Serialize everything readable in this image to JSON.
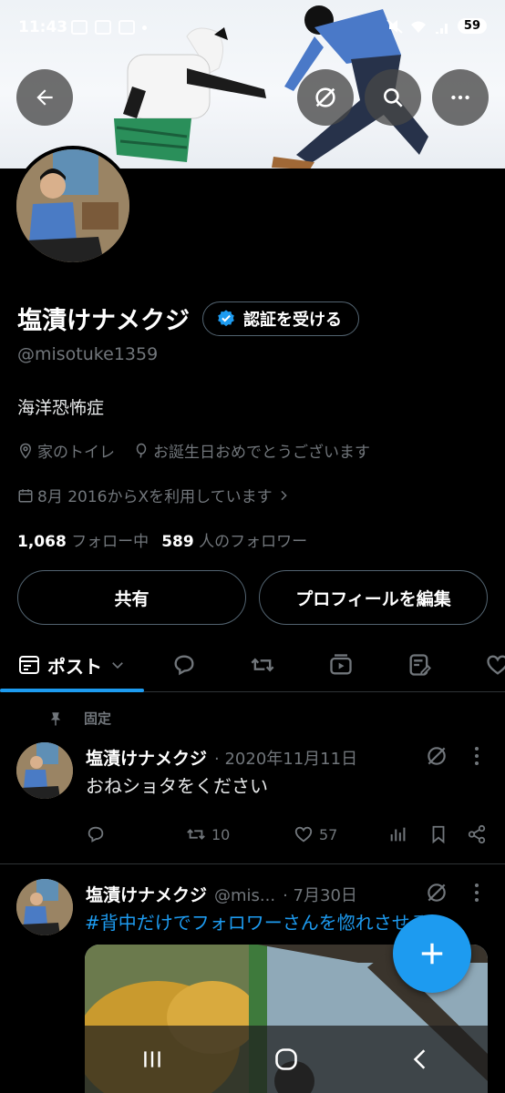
{
  "status_bar": {
    "time": "11:43",
    "battery": "59"
  },
  "header": {
    "back_icon": "arrow-left-icon",
    "grok_icon": "grok-icon",
    "search_icon": "search-icon",
    "more_icon": "more-horizontal-icon"
  },
  "profile": {
    "display_name": "塩漬けナメクジ",
    "verify_label": "認証を受ける",
    "handle": "@misotuke1359",
    "bio": "海洋恐怖症",
    "location": "家のトイレ",
    "birthday": "お誕生日おめでとうございます",
    "joined": "8月 2016からXを利用しています",
    "following_count": "1,068",
    "following_label": "フォロー中",
    "followers_count": "589",
    "followers_label": "人のフォロワー",
    "share_label": "共有",
    "edit_label": "プロフィールを編集"
  },
  "tabs": {
    "posts_label": "ポスト"
  },
  "posts": [
    {
      "pinned_label": "固定",
      "name": "塩漬けナメクジ",
      "date": "· 2020年11月11日",
      "text": "おねショタをください",
      "retweets": "10",
      "likes": "57"
    },
    {
      "name": "塩漬けナメクジ",
      "handle": "@mis...",
      "date": "· 7月30日",
      "text": "#背中だけでフォロワーさんを惚れさせる"
    }
  ],
  "colors": {
    "accent": "#1d9bf0",
    "muted": "#71767b",
    "border": "#536471"
  }
}
